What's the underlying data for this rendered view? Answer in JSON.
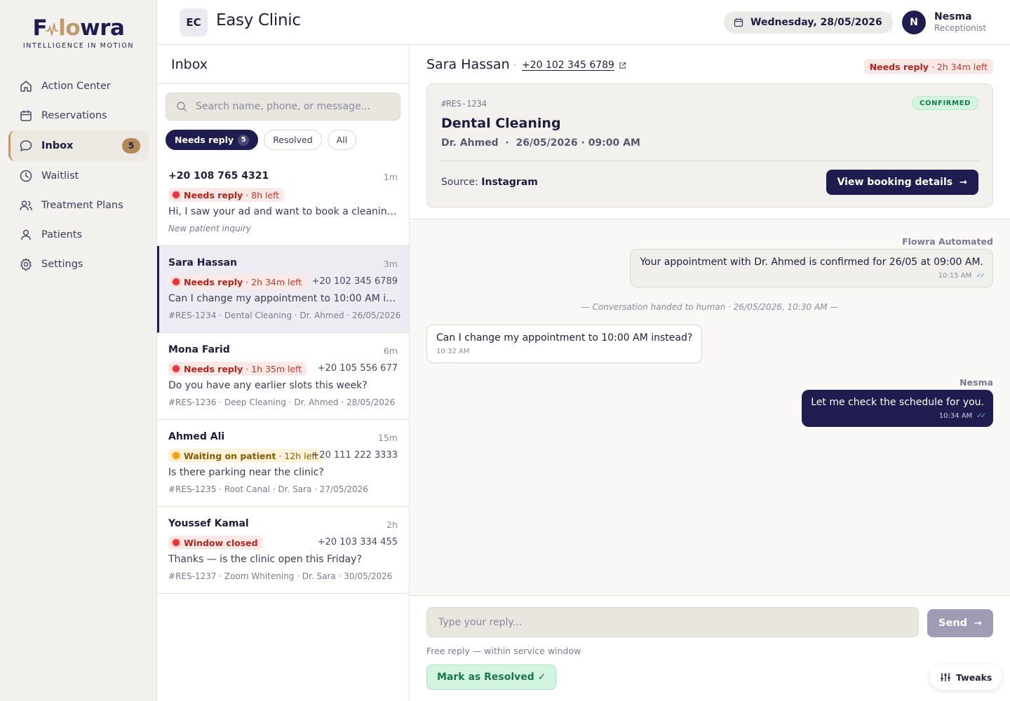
{
  "brand": {
    "logo_text_pre": "F",
    "logo_text_mid": "lo",
    "logo_text_post": "wra",
    "tagline": "INTELLIGENCE IN MOTION",
    "accent_color": "#c09a6b",
    "navy_color": "#1f1d4f"
  },
  "sidebar": {
    "items": [
      {
        "label": "Action Center",
        "icon": "home-icon"
      },
      {
        "label": "Reservations",
        "icon": "calendar-icon"
      },
      {
        "label": "Inbox",
        "icon": "chat-icon",
        "badge": "5"
      },
      {
        "label": "Waitlist",
        "icon": "clock-icon"
      },
      {
        "label": "Treatment Plans",
        "icon": "users-icon"
      },
      {
        "label": "Patients",
        "icon": "user-icon"
      },
      {
        "label": "Settings",
        "icon": "gear-icon"
      }
    ]
  },
  "header": {
    "clinic_initials": "EC",
    "clinic_name": "Easy Clinic",
    "date": "Wednesday, 28/05/2026",
    "user_initial": "N",
    "user_name": "Nesma",
    "user_role": "Receptionist"
  },
  "inbox": {
    "title": "Inbox",
    "search_placeholder": "Search name, phone, or message...",
    "filters": [
      {
        "label": "Needs reply",
        "count": "5"
      },
      {
        "label": "Resolved"
      },
      {
        "label": "All"
      }
    ],
    "conversations": [
      {
        "name": "+20 108 765 4321",
        "time": "1m",
        "status": "Needs reply",
        "left": "· 8h left",
        "phone": "",
        "message": "Hi, I saw your ad and want to book a cleaning...",
        "meta": "New patient inquiry"
      },
      {
        "name": "Sara Hassan",
        "time": "3m",
        "status": "Needs reply",
        "left": "· 2h 34m left",
        "phone": "+20 102 345 6789",
        "message": "Can I change my appointment to 10:00 AM instead?",
        "meta": "#RES-1234 · Dental Cleaning · Dr. Ahmed · 26/05/2026"
      },
      {
        "name": "Mona Farid",
        "time": "6m",
        "status": "Needs reply",
        "left": "· 1h 35m left",
        "phone": "+20 105 556 677",
        "message": "Do you have any earlier slots this week?",
        "meta": "#RES-1236 · Deep Cleaning · Dr. Ahmed · 28/05/2026"
      },
      {
        "name": "Ahmed Ali",
        "time": "15m",
        "status": "Waiting on patient",
        "left": "· 12h left",
        "phone": "+20 111 222 3333",
        "message": "Is there parking near the clinic?",
        "meta": "#RES-1235 · Root Canal · Dr. Sara · 27/05/2026"
      },
      {
        "name": "Youssef Kamal",
        "time": "2h",
        "status": "Window closed",
        "left": "",
        "phone": "+20 103 334 455",
        "message": "Thanks — is the clinic open this Friday?",
        "meta": "#RES-1237 · Zoom Whitening · Dr. Sara · 30/05/2026"
      }
    ]
  },
  "detail": {
    "name": "Sara Hassan",
    "separator": "·",
    "phone": "+20 102 345 6789",
    "status": "Needs reply",
    "left": "· 2h 34m left",
    "booking": {
      "id": "#RES-1234",
      "state": "CONFIRMED",
      "title": "Dental Cleaning",
      "doctor": "Dr. Ahmed",
      "datetime": "26/05/2026 · 09:00 AM",
      "source_label": "Source:",
      "source": "Instagram",
      "button": "View booking details"
    },
    "messages": {
      "auto_sender": "Flowra Automated",
      "auto_text": "Your appointment with Dr. Ahmed is confirmed for 26/05 at 09:00 AM.",
      "auto_time": "10:15 AM",
      "handoff": "— Conversation handed to human · 26/05/2026, 10:30 AM —",
      "in_text": "Can I change my appointment to 10:00 AM instead?",
      "in_time": "10:32 AM",
      "out_sender": "Nesma",
      "out_text": "Let me check the schedule for you.",
      "out_time": "10:34 AM"
    },
    "reply_placeholder": "Type your reply...",
    "send_label": "Send",
    "hint": "Free reply — within service window",
    "resolve_label": "Mark as Resolved ✓"
  },
  "tweaks_label": "Tweaks"
}
